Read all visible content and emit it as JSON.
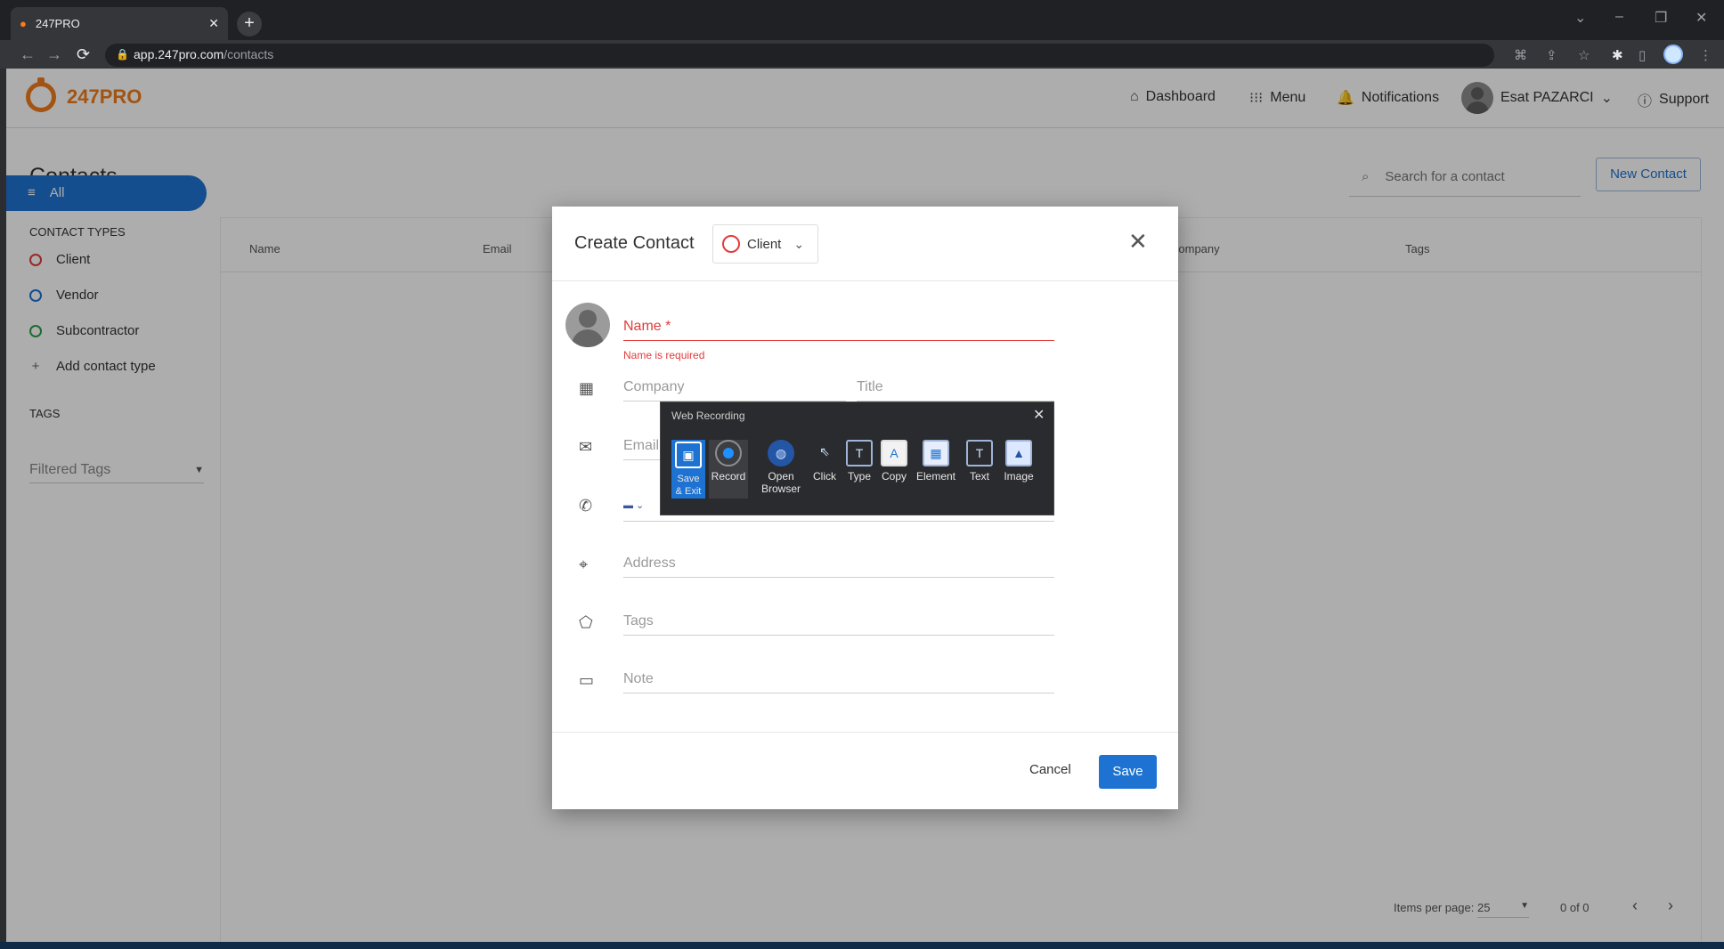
{
  "browser": {
    "tab_title": "247PRO",
    "tab_close": "✕",
    "new_tab": "+",
    "url_host": "app.247pro.com",
    "url_path": "/contacts",
    "window_controls": [
      "⌄",
      "–",
      "❐",
      "✕"
    ]
  },
  "header": {
    "brand": "247PRO",
    "nav": {
      "dashboard": "Dashboard",
      "menu": "Menu",
      "notifications": "Notifications",
      "user": "Esat PAZARCI",
      "support": "Support"
    }
  },
  "page": {
    "title": "Contacts",
    "search_placeholder": "Search for a contact",
    "new_contact": "New Contact"
  },
  "sidebar": {
    "all": "All",
    "contact_types_heading": "CONTACT TYPES",
    "types": [
      {
        "label": "Client",
        "color": "#e23b3b"
      },
      {
        "label": "Vendor",
        "color": "#1e73d2"
      },
      {
        "label": "Subcontractor",
        "color": "#2e9e44"
      }
    ],
    "add_type": "Add contact type",
    "tags_heading": "TAGS",
    "filtered_tags": "Filtered Tags"
  },
  "table": {
    "columns": [
      "Name",
      "Email",
      "Company",
      "Tags"
    ],
    "items_per_page_label": "Items per page:",
    "items_per_page": "25",
    "range": "0 of 0"
  },
  "modal": {
    "title": "Create Contact",
    "type": "Client",
    "fields": {
      "name": "Name *",
      "name_error": "Name is required",
      "company": "Company",
      "title": "Title",
      "email": "Email",
      "address": "Address",
      "tags": "Tags",
      "note": "Note"
    },
    "cancel": "Cancel",
    "save": "Save"
  },
  "web_recording": {
    "title": "Web Recording",
    "buttons": [
      {
        "label": "Save\n& Exit",
        "icon": "floppy-icon"
      },
      {
        "label": "Record",
        "icon": "record-icon"
      },
      {
        "label": "Open\nBrowser",
        "icon": "globe-icon"
      },
      {
        "label": "Click",
        "icon": "cursor-click-icon"
      },
      {
        "label": "Type",
        "icon": "type-icon"
      },
      {
        "label": "Copy",
        "icon": "copy-icon"
      },
      {
        "label": "Element",
        "icon": "element-grid-icon"
      },
      {
        "label": "Text",
        "icon": "text-icon"
      },
      {
        "label": "Image",
        "icon": "image-icon"
      }
    ]
  },
  "colors": {
    "accent": "#1e73d2",
    "brand": "#f07c1b",
    "error": "#e23b3b"
  }
}
